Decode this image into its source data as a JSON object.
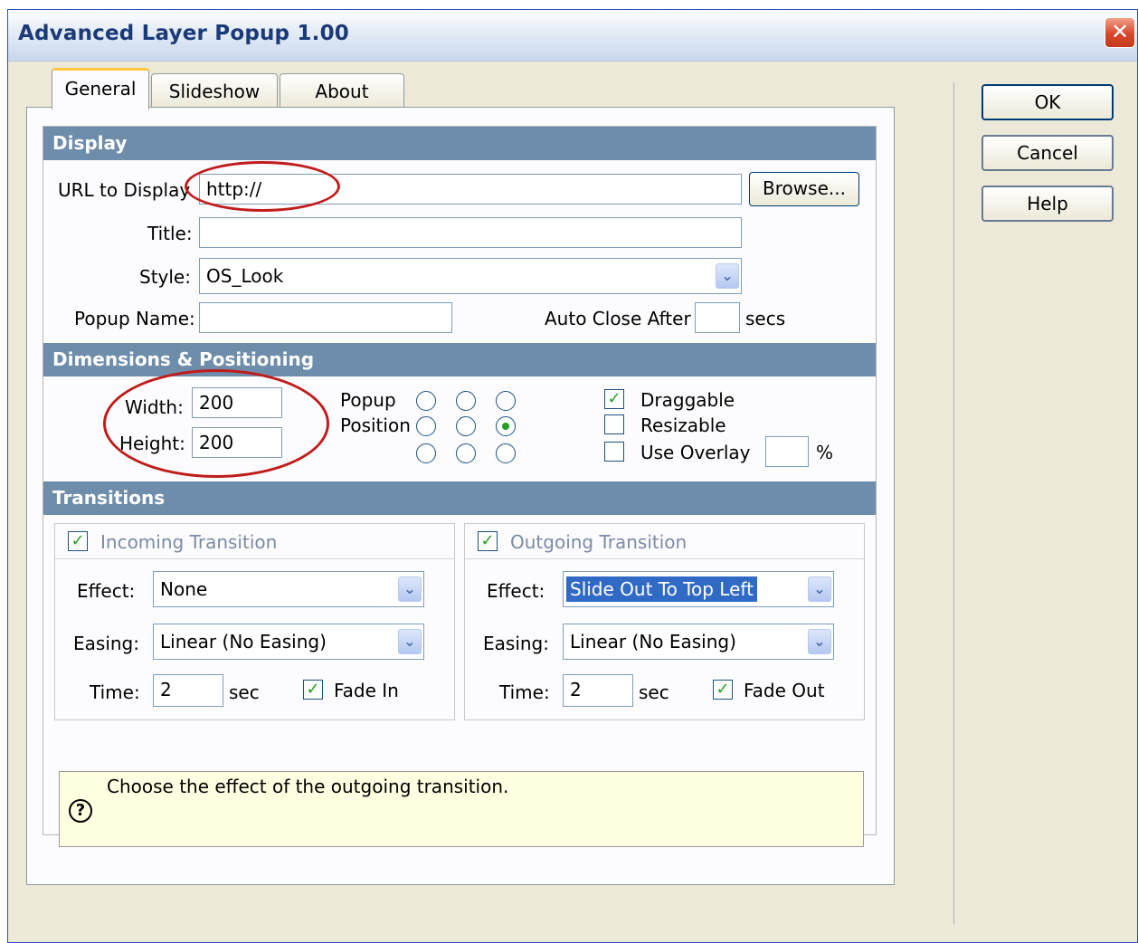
{
  "window": {
    "title": "Advanced Layer Popup 1.00",
    "close_glyph": "✕"
  },
  "tabs": [
    "General",
    "Slideshow",
    "About"
  ],
  "buttons": {
    "ok": "OK",
    "cancel": "Cancel",
    "help": "Help",
    "browse": "Browse..."
  },
  "display": {
    "header": "Display",
    "url_label": "URL to Display",
    "url_value": "http://",
    "title_label": "Title:",
    "title_value": "",
    "style_label": "Style:",
    "style_value": "OS_Look",
    "popup_name_label": "Popup Name:",
    "popup_name_value": "",
    "auto_close_label": "Auto Close After",
    "auto_close_value": "",
    "secs_label": "secs"
  },
  "dimensions": {
    "header": "Dimensions & Positioning",
    "width_label": "Width:",
    "width_value": "200",
    "height_label": "Height:",
    "height_value": "200",
    "popup_label": "Popup",
    "position_label": "Position",
    "selected_position": "middle-right",
    "draggable_label": "Draggable",
    "draggable_checked": true,
    "resizable_label": "Resizable",
    "resizable_checked": false,
    "overlay_label": "Use Overlay",
    "overlay_checked": false,
    "overlay_value": "",
    "percent": "%"
  },
  "transitions": {
    "header": "Transitions",
    "incoming": {
      "title": "Incoming Transition",
      "enabled": true,
      "effect_label": "Effect:",
      "effect_value": "None",
      "easing_label": "Easing:",
      "easing_value": "Linear (No Easing)",
      "time_label": "Time:",
      "time_value": "2",
      "sec_label": "sec",
      "fade_label": "Fade In",
      "fade_checked": true
    },
    "outgoing": {
      "title": "Outgoing Transition",
      "enabled": true,
      "effect_label": "Effect:",
      "effect_value": "Slide Out To Top Left",
      "easing_label": "Easing:",
      "easing_value": "Linear (No Easing)",
      "time_label": "Time:",
      "time_value": "2",
      "sec_label": "sec",
      "fade_label": "Fade Out",
      "fade_checked": true
    }
  },
  "hint": {
    "text": "Choose the effect of the outgoing transition.",
    "icon": "?"
  },
  "colors": {
    "section_header": "#6e8daa",
    "annotation": "#c11c1c",
    "hint_bg": "#ffffe1",
    "check": "#21a121"
  }
}
